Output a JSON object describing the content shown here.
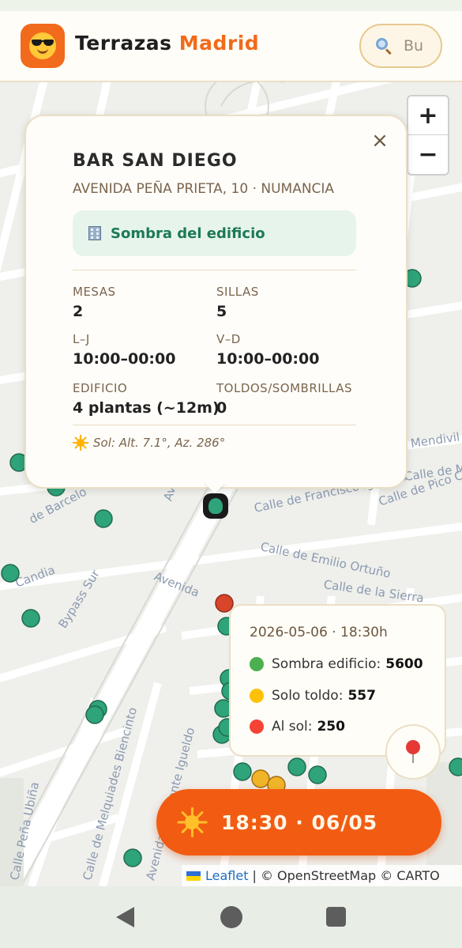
{
  "header": {
    "brand_main": "Terrazas",
    "brand_accent": "Madrid",
    "search_placeholder": "Bu",
    "logo_icon": "sunglasses-emoji-icon",
    "accent_color": "#f26a1b"
  },
  "map": {
    "zoom_in_label": "+",
    "zoom_out_label": "−",
    "street_labels": [
      {
        "text": "Avenida"
      },
      {
        "text": "Bypass Sur"
      },
      {
        "text": "Avenida"
      },
      {
        "text": "Calle de Francisco Iglesias"
      },
      {
        "text": "Calle de Emilio Ortuño"
      },
      {
        "text": "Calle de Pico Cejo"
      },
      {
        "text": "Avenida del Monte Igueldo"
      },
      {
        "text": "Calle de Melquiades Biencinto"
      },
      {
        "text": "Calle Peña Ubiña"
      },
      {
        "text": "Calle de la Sierra"
      },
      {
        "text": "Calle de Meira"
      },
      {
        "text": "Mendivil"
      },
      {
        "text": "de Barcelo"
      },
      {
        "text": "Candia"
      }
    ],
    "attribution": {
      "leaflet": "Leaflet",
      "rest": "| © OpenStreetMap © CARTO"
    }
  },
  "popup": {
    "close_label": "×",
    "name": "BAR SAN DIEGO",
    "address": "AVENIDA PEÑA PRIETA, 10 · NUMANCIA",
    "shade_icon": "building-icon",
    "shade_label": "Sombra del edificio",
    "fields": {
      "mesas_label": "MESAS",
      "mesas_value": "2",
      "sillas_label": "SILLAS",
      "sillas_value": "5",
      "lj_label": "L–J",
      "lj_value": "10:00–00:00",
      "vd_label": "V–D",
      "vd_value": "10:00–00:00",
      "edificio_label": "EDIFICIO",
      "edificio_value": "4 plantas (~12m)",
      "toldos_label": "TOLDOS/SOMBRILLAS",
      "toldos_value": "0"
    },
    "sun_text": "Sol: Alt. 7.1°, Az. 286°"
  },
  "stats": {
    "datetime": "2026-05-06 · 18:30h",
    "rows": [
      {
        "label": "Sombra edificio:",
        "value": "5600",
        "color": "#4caf50"
      },
      {
        "label": "Solo toldo:",
        "value": "557",
        "color": "#ffc107"
      },
      {
        "label": "Al sol:",
        "value": "250",
        "color": "#f44336"
      }
    ]
  },
  "locate_icon": "pin-icon",
  "time_button": {
    "label": "18:30 · 06/05",
    "icon": "sun-icon"
  },
  "colors": {
    "shade_green": "#2fa37a",
    "toldo_yellow": "#f0b429",
    "sun_red": "#d8452b",
    "cta_orange": "#f25c12"
  }
}
